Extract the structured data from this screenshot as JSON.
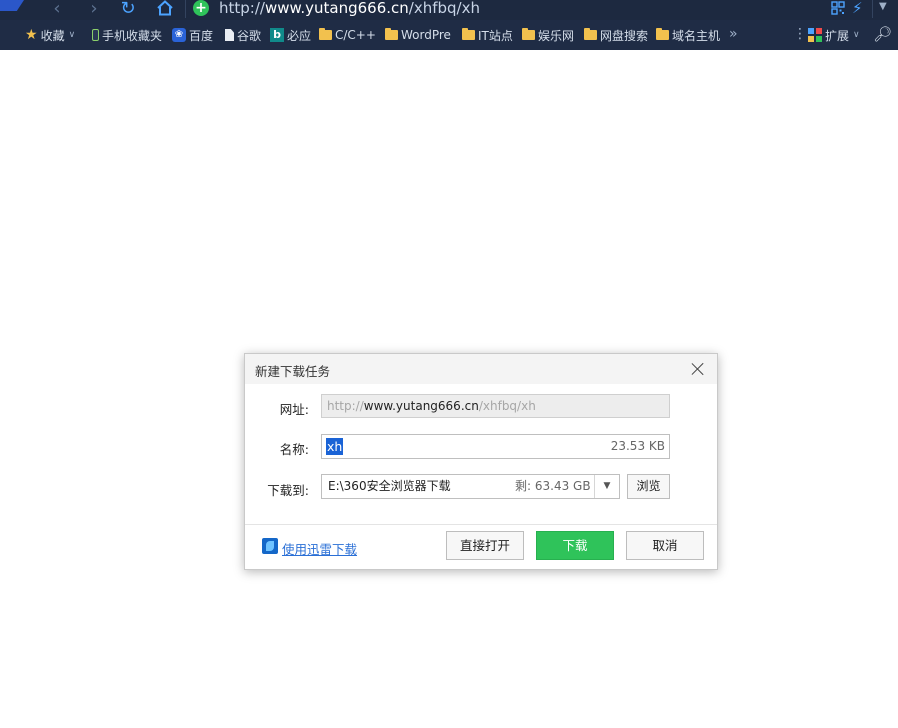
{
  "toolbar": {
    "url_prefix": "http://",
    "url_host": "www.yutang666.cn",
    "url_path": "/xhfbq/xh"
  },
  "bookmarks": {
    "items": [
      {
        "label": "收藏",
        "icon": "star-icon"
      },
      {
        "label": "手机收藏夹",
        "icon": "phone-icon"
      },
      {
        "label": "百度",
        "icon": "baidu-icon"
      },
      {
        "label": "谷歌",
        "icon": "document-icon"
      },
      {
        "label": "必应",
        "icon": "bing-icon"
      },
      {
        "label": "C/C++",
        "icon": "folder-icon"
      },
      {
        "label": "WordPre",
        "icon": "folder-icon"
      },
      {
        "label": "IT站点",
        "icon": "folder-icon"
      },
      {
        "label": "娱乐网",
        "icon": "folder-icon"
      },
      {
        "label": "网盘搜索",
        "icon": "folder-icon"
      },
      {
        "label": "域名主机",
        "icon": "folder-icon"
      }
    ],
    "extensions_label": "扩展"
  },
  "dialog": {
    "title": "新建下载任务",
    "url_label": "网址:",
    "url_prefix": "http://",
    "url_host": "www.yutang666.cn",
    "url_path": "/xhfbq/xh",
    "name_label": "名称:",
    "name_value": "xh",
    "file_size": "23.53 KB",
    "dest_label": "下载到:",
    "dest_path": "E:\\360安全浏览器下载",
    "free_space": "剩: 63.43 GB",
    "browse_label": "浏览",
    "thunder_link": "使用迅雷下载",
    "open_label": "直接打开",
    "download_label": "下载",
    "cancel_label": "取消",
    "colors": {
      "download_button": "#2fc35a",
      "selection": "#1a63d6",
      "link": "#2a6fd6"
    }
  }
}
